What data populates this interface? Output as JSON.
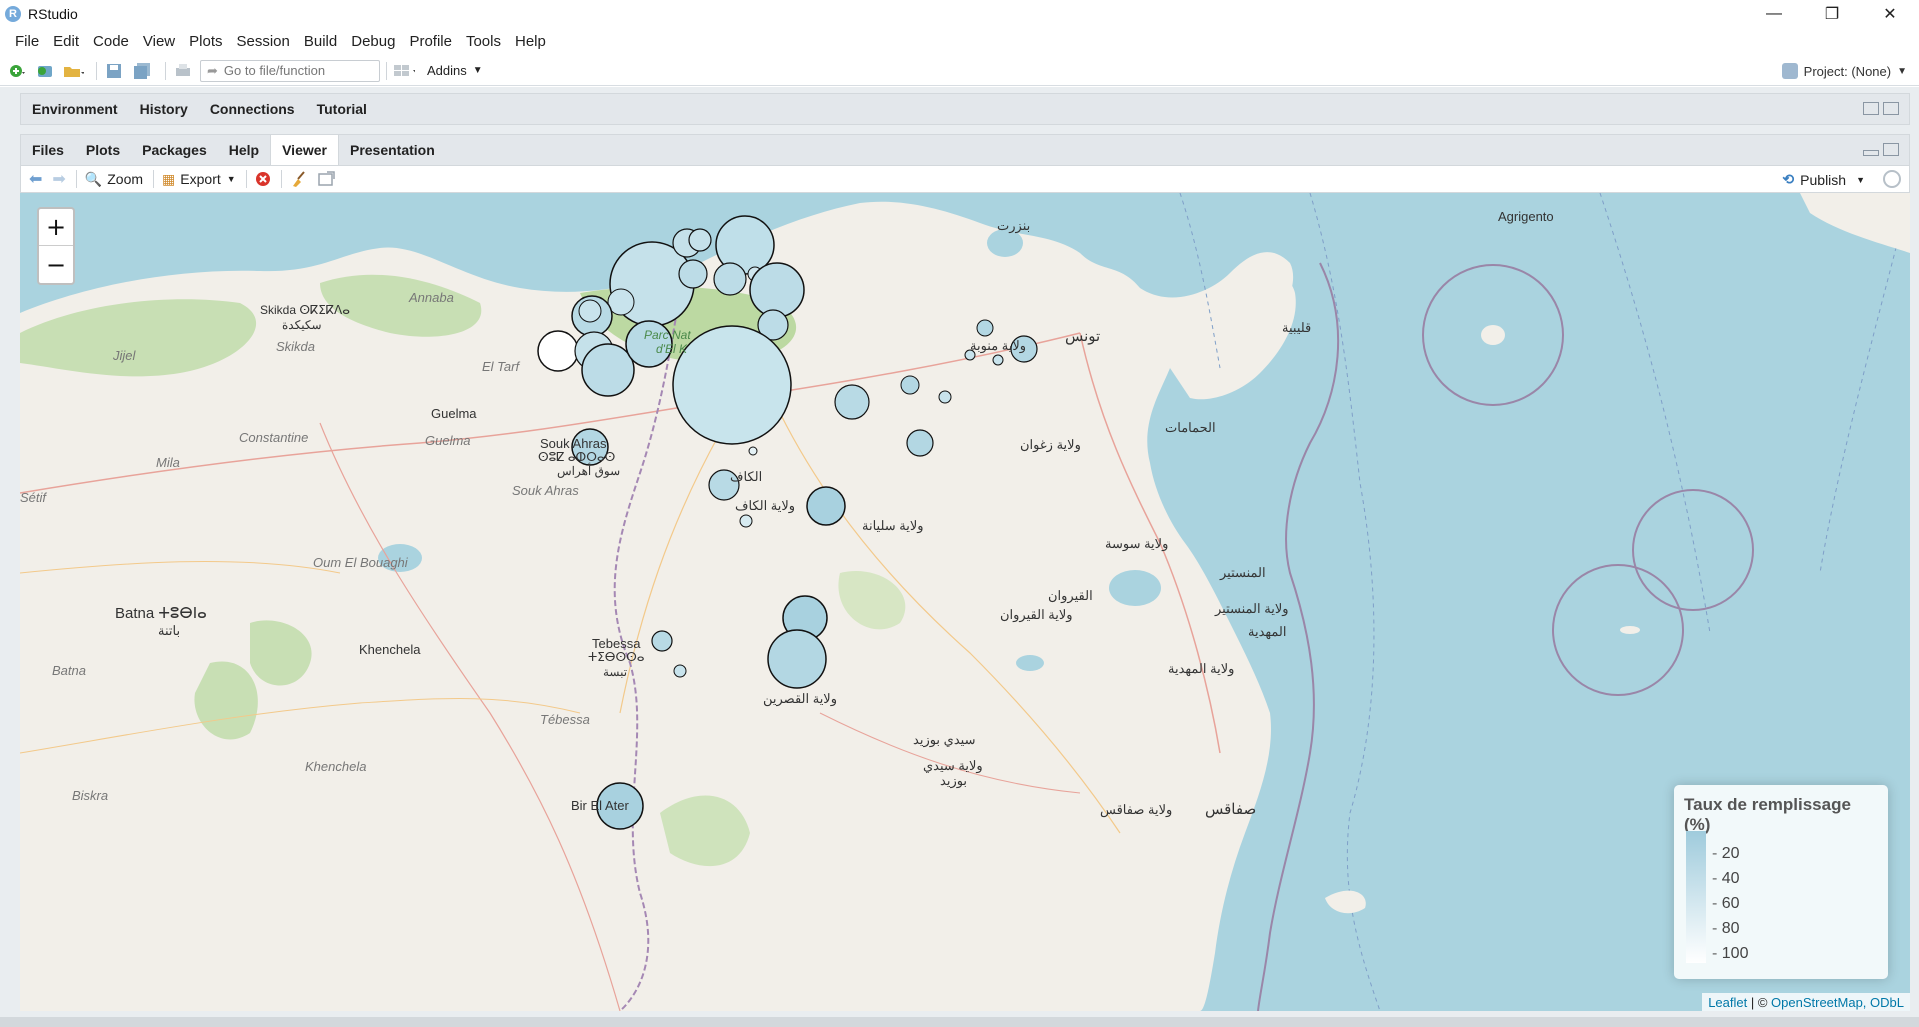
{
  "window": {
    "app_icon": "R",
    "title": "RStudio",
    "minimize": "—",
    "maximize": "❐",
    "close": "✕"
  },
  "menu": [
    "File",
    "Edit",
    "Code",
    "View",
    "Plots",
    "Session",
    "Build",
    "Debug",
    "Profile",
    "Tools",
    "Help"
  ],
  "toolbar": {
    "goto_placeholder": "Go to file/function",
    "addins_label": "Addins",
    "project_label": "Project: (None)"
  },
  "upper_pane": {
    "tabs": [
      "Environment",
      "History",
      "Connections",
      "Tutorial"
    ]
  },
  "lower_pane": {
    "tabs": [
      "Files",
      "Plots",
      "Packages",
      "Help",
      "Viewer",
      "Presentation"
    ],
    "active_tab": "Viewer",
    "zoom_label": "Zoom",
    "export_label": "Export",
    "publish_label": "Publish"
  },
  "map": {
    "zoom_in": "+",
    "zoom_out": "−",
    "legend": {
      "title": "Taux de remplissage (%)",
      "ticks": [
        "20",
        "40",
        "60",
        "80",
        "100"
      ]
    },
    "attribution": {
      "leaflet": "Leaflet",
      "sep": " | © ",
      "osm": "OpenStreetMap, ODbL"
    },
    "labels": {
      "agrigento": "Agrigento",
      "skikda1": "Skikda ⵙⴽⵉⴽⴷⴰ",
      "skikda_ar": "سكيكدة",
      "skikda2": "Skikda",
      "annaba": "Annaba",
      "jijel": "Jijel",
      "eltarf": "El Tarf",
      "guelma1": "Guelma",
      "guelma2": "Guelma",
      "constantine": "Constantine",
      "mila": "Mila",
      "soukahras1": "Souk Ahras",
      "soukahras2": "ⵙⵓⵇ ⴰⵀⵔⴰⵙ",
      "soukahras_ar": "سوق أهراس",
      "soukahras3": "Souk Ahras",
      "setif": "Sétif",
      "oumelbouaghi": "Oum El Bouaghi",
      "batna1": "Batna ⵜⵓⴱⵏⴰ",
      "batna_ar": "باتنة",
      "batna2": "Batna",
      "khenchela1": "Khenchela",
      "khenchela2": "Khenchela",
      "tebessa1": "Tebessa",
      "tebessa2": "ⵜⵉⴱⵙⵙⴰ",
      "tebessa_ar": "تبسة",
      "tebessa3": "Tébessa",
      "biskra": "Biskra",
      "birelater": "Bir El Ater",
      "bizerte": "بنزرت",
      "tunis": "تونس",
      "manouba": "ولاية منوبة",
      "kelibia": "قليبية",
      "hammamet": "الحمامات",
      "zaghouan": "ولاية زغوان",
      "kef": "الكاف",
      "kef_gov": "ولاية الكاف",
      "siliana": "ولاية سليانة",
      "sousse": "ولاية سوسة",
      "monastir": "المنستير",
      "monastir_gov": "ولاية المنستير",
      "kairouan": "القيروان",
      "kairouan_gov": "ولاية القيروان",
      "mahdia": "المهدية",
      "mahdia_gov": "ولاية المهدية",
      "kasserine": "ولاية القصرين",
      "sidibouzid": "سيدي بوزيد",
      "sidibouzid_gov1": "ولاية سيدي",
      "sidibouzid_gov2": "بوزيد",
      "sfax": "صفاقس",
      "sfax_gov": "ولاية صفاقس",
      "parcnat1": "Parc Nat",
      "parcnat2": "d'El K"
    }
  }
}
